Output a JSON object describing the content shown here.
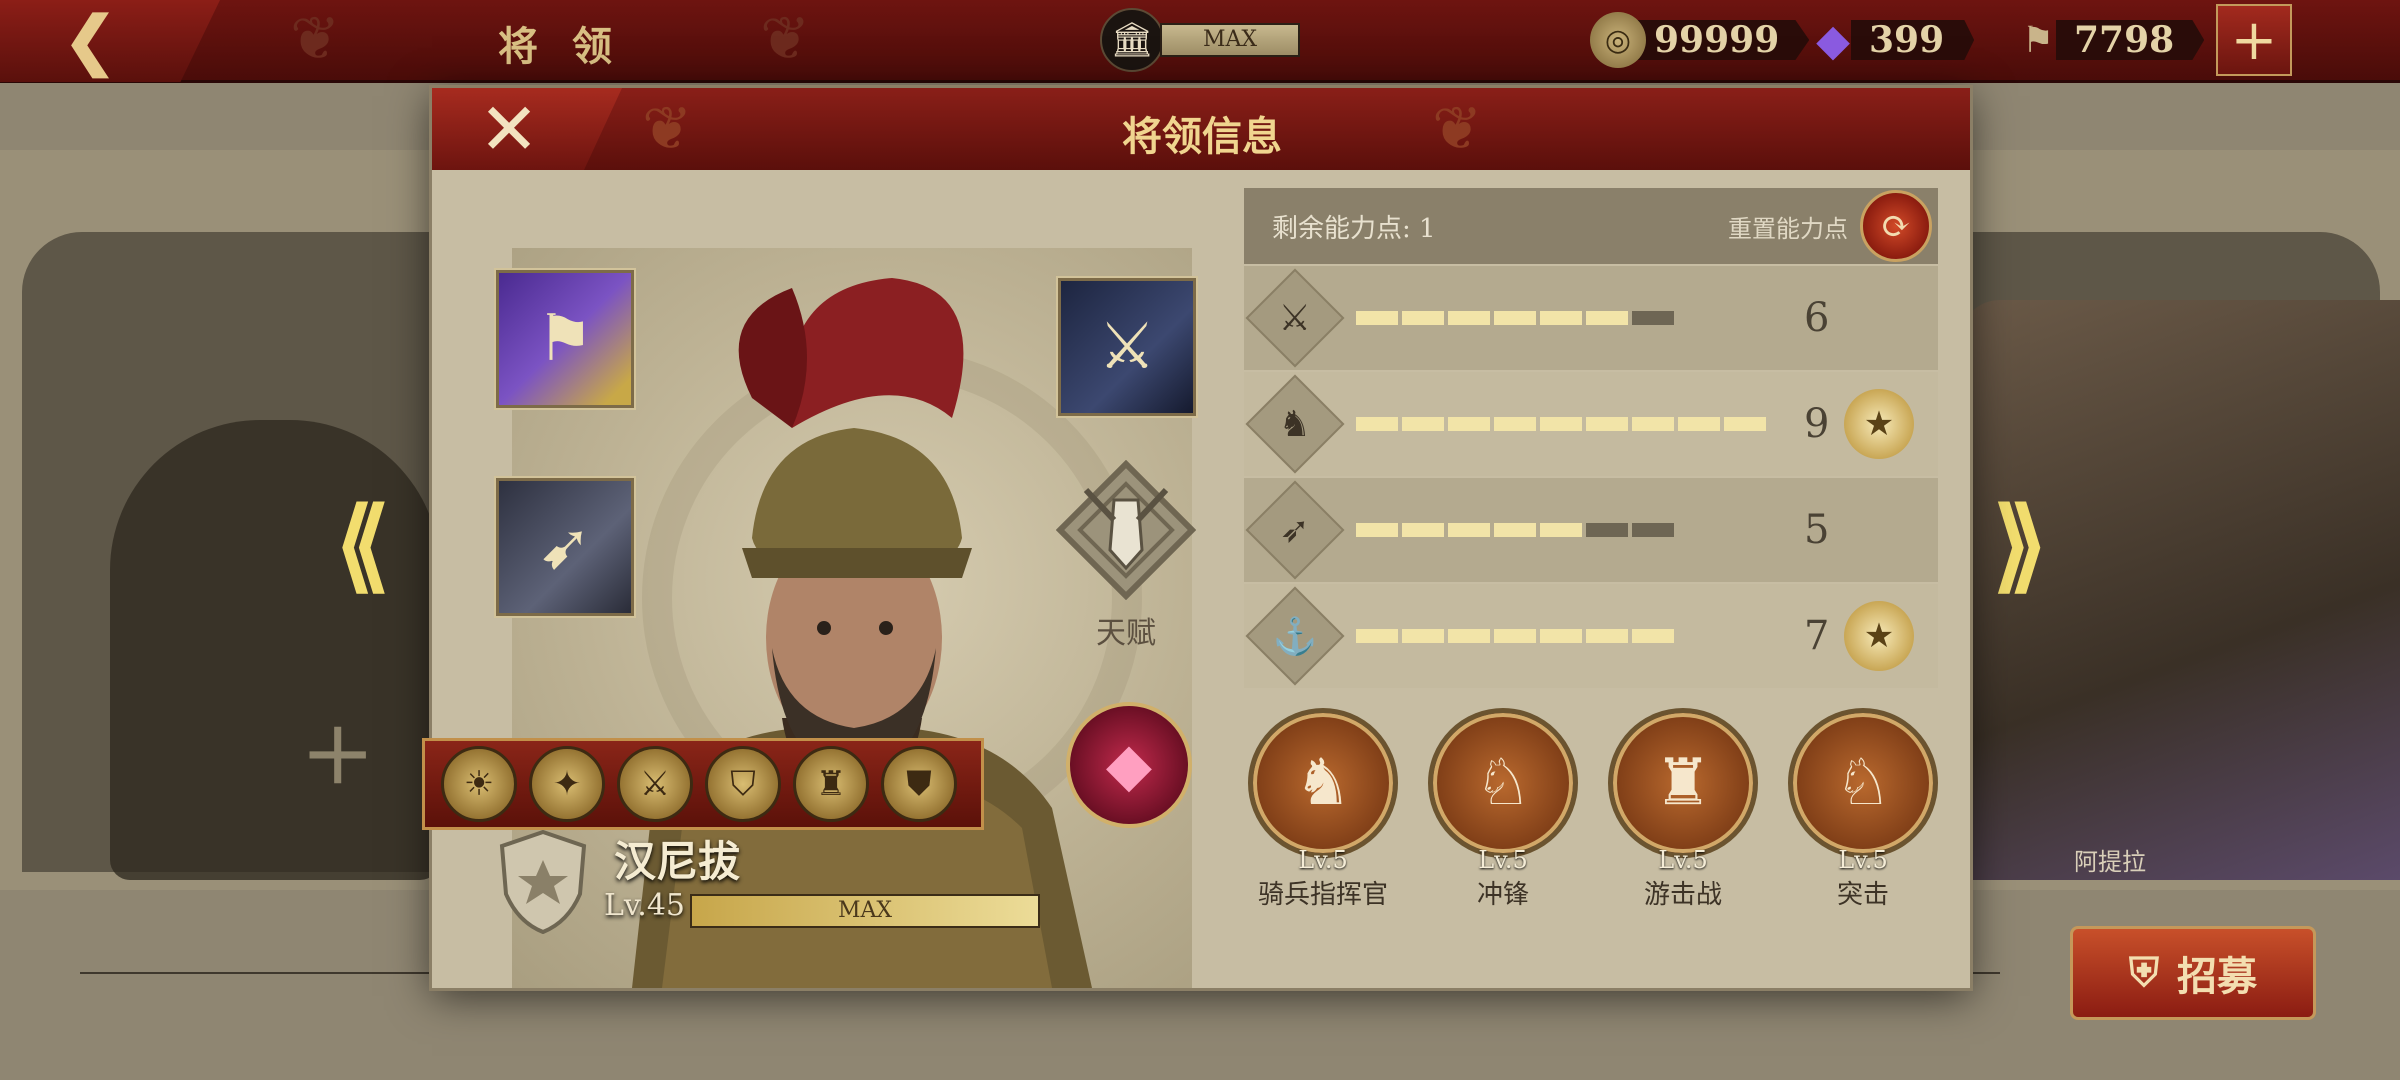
{
  "topbar": {
    "back_icon": "chevron-left-icon",
    "title": "将 领",
    "building_level": "MAX",
    "resources": [
      {
        "name": "coin",
        "icon": "coin-icon",
        "value": "99999",
        "color": "#b39a62"
      },
      {
        "name": "gem",
        "icon": "purple-crystal-icon",
        "value": "399",
        "color": "#6a3fb0"
      },
      {
        "name": "spqr",
        "icon": "spqr-banner-icon",
        "value": "7798",
        "color": "#b7a27a"
      }
    ],
    "add_icon": "plus-icon"
  },
  "background": {
    "right_general_name": "阿提拉",
    "recruit_label": "招募"
  },
  "modal": {
    "title": "将领信息",
    "hero": {
      "name": "汉尼拔",
      "level": "Lv.45",
      "exp_label": "MAX",
      "talent_label": "天赋"
    },
    "stats": {
      "remaining_points": "剩余能力点: 1",
      "reset_label": "重置能力点",
      "rows": [
        {
          "icon": "sword-icon",
          "glyph": "⚔",
          "value": "6",
          "filled": 6,
          "max": 7,
          "star": false
        },
        {
          "icon": "horse-head-icon",
          "glyph": "♞",
          "value": "9",
          "filled": 9,
          "max": 9,
          "star": true
        },
        {
          "icon": "bow-icon",
          "glyph": "➶",
          "value": "5",
          "filled": 5,
          "max": 7,
          "star": false
        },
        {
          "icon": "anchor-icon",
          "glyph": "⚓",
          "value": "7",
          "filled": 7,
          "max": 7,
          "star": true
        }
      ]
    },
    "skills": [
      {
        "level": "Lv.5",
        "name": "骑兵指挥官",
        "glyph": "♞"
      },
      {
        "level": "Lv.5",
        "name": "冲锋",
        "glyph": "♘"
      },
      {
        "level": "Lv.5",
        "name": "游击战",
        "glyph": "♜"
      },
      {
        "level": "Lv.5",
        "name": "突击",
        "glyph": "♘"
      }
    ],
    "badges": [
      "☀",
      "✦",
      "⚔",
      "⛉",
      "♜",
      "⛊"
    ],
    "colors": {
      "stat_fill": "#f2e4a8",
      "stat_empty": "#6e6654",
      "accent_red": "#7a1812"
    }
  }
}
